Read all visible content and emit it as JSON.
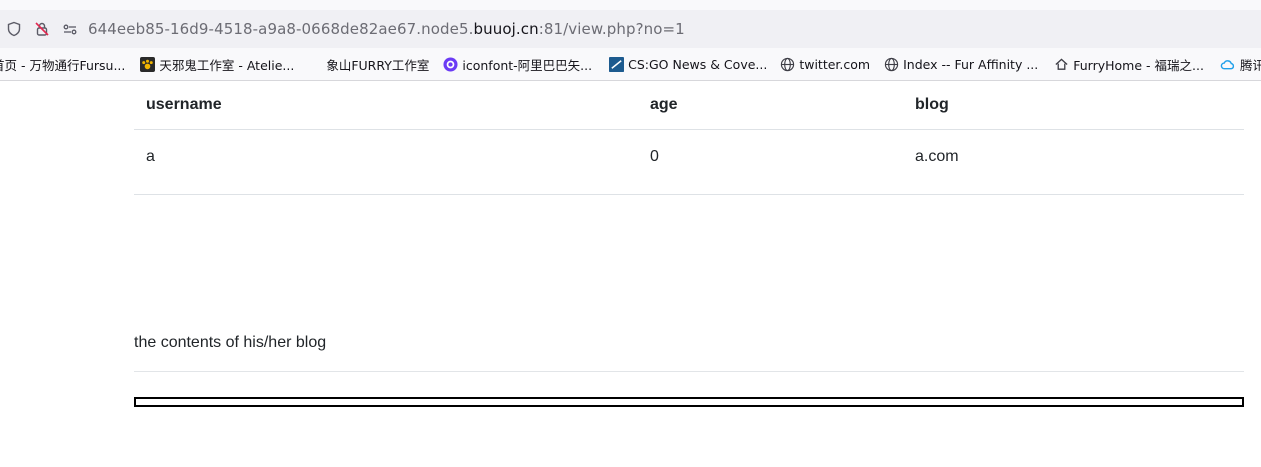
{
  "browser": {
    "url_prefix": "644eeb85-16d9-4518-a9a8-0668de82ae67.node5.",
    "url_domain": "buuoj.cn",
    "url_suffix": ":81/view.php?no=1",
    "bookmarks": [
      {
        "label": "首页 - 万物通行Fursu...",
        "icon": "none"
      },
      {
        "label": "天邪鬼工作室 - Atelie...",
        "icon": "paw-icon"
      },
      {
        "label": "象山FURRY工作室",
        "icon": "none"
      },
      {
        "label": "iconfont-阿里巴巴矢...",
        "icon": "iconfont-icon"
      },
      {
        "label": "CS:GO News & Cove...",
        "icon": "csgo-icon"
      },
      {
        "label": "twitter.com",
        "icon": "globe-icon"
      },
      {
        "label": "Index -- Fur Affinity ...",
        "icon": "globe-icon"
      },
      {
        "label": "FurryHome - 福瑞之...",
        "icon": "furryhome-icon"
      },
      {
        "label": "腾讯云新春优惠",
        "icon": "cloud-icon"
      }
    ]
  },
  "table": {
    "headers": [
      "username",
      "age",
      "blog"
    ],
    "rows": [
      [
        "a",
        "0",
        "a.com"
      ]
    ]
  },
  "blog_caption": "the contents of his/her blog"
}
